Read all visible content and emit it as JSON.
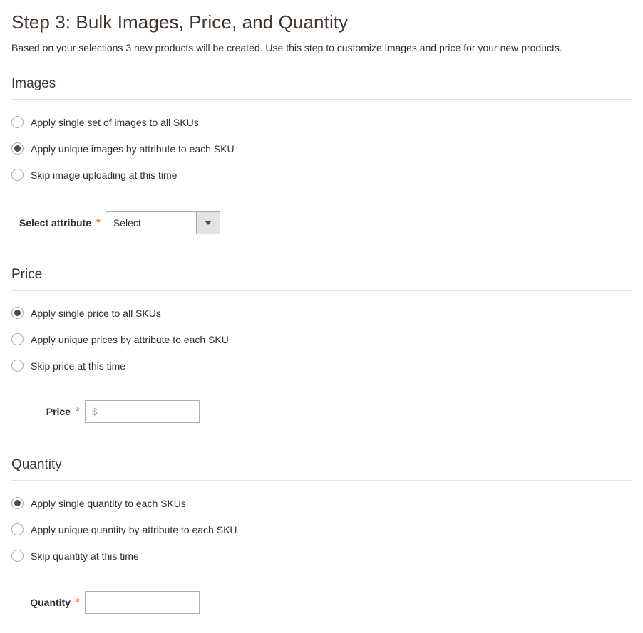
{
  "header": {
    "title": "Step 3: Bulk Images, Price, and Quantity",
    "subtitle": "Based on your selections 3 new products will be created. Use this step to customize images and price for your new products."
  },
  "colors": {
    "heading": "#41362f",
    "text": "#303030",
    "required_asterisk": "#e04f00",
    "rule": "#e3e3e3",
    "radio_border": "#adadad",
    "radio_checked_dot": "#514943",
    "select_button_bg": "#e3e3e3",
    "placeholder": "#a6a6a6"
  },
  "required_symbol": "*",
  "images": {
    "section_title": "Images",
    "options": [
      {
        "label": "Apply single set of images to all SKUs",
        "checked": false
      },
      {
        "label": "Apply unique images by attribute to each SKU",
        "checked": true
      },
      {
        "label": "Skip image uploading at this time",
        "checked": false
      }
    ],
    "attribute_field": {
      "label": "Select attribute",
      "required": true,
      "selected_value": "Select",
      "dropdown_icon": "chevron-down-icon"
    }
  },
  "price": {
    "section_title": "Price",
    "options": [
      {
        "label": "Apply single price to all SKUs",
        "checked": true
      },
      {
        "label": "Apply unique prices by attribute to each SKU",
        "checked": false
      },
      {
        "label": "Skip price at this time",
        "checked": false
      }
    ],
    "price_field": {
      "label": "Price",
      "required": true,
      "value": "",
      "placeholder": "$"
    }
  },
  "quantity": {
    "section_title": "Quantity",
    "options": [
      {
        "label": "Apply single quantity to each SKUs",
        "checked": true
      },
      {
        "label": "Apply unique quantity by attribute to each SKU",
        "checked": false
      },
      {
        "label": "Skip quantity at this time",
        "checked": false
      }
    ],
    "quantity_field": {
      "label": "Quantity",
      "required": true,
      "value": "",
      "placeholder": ""
    }
  }
}
